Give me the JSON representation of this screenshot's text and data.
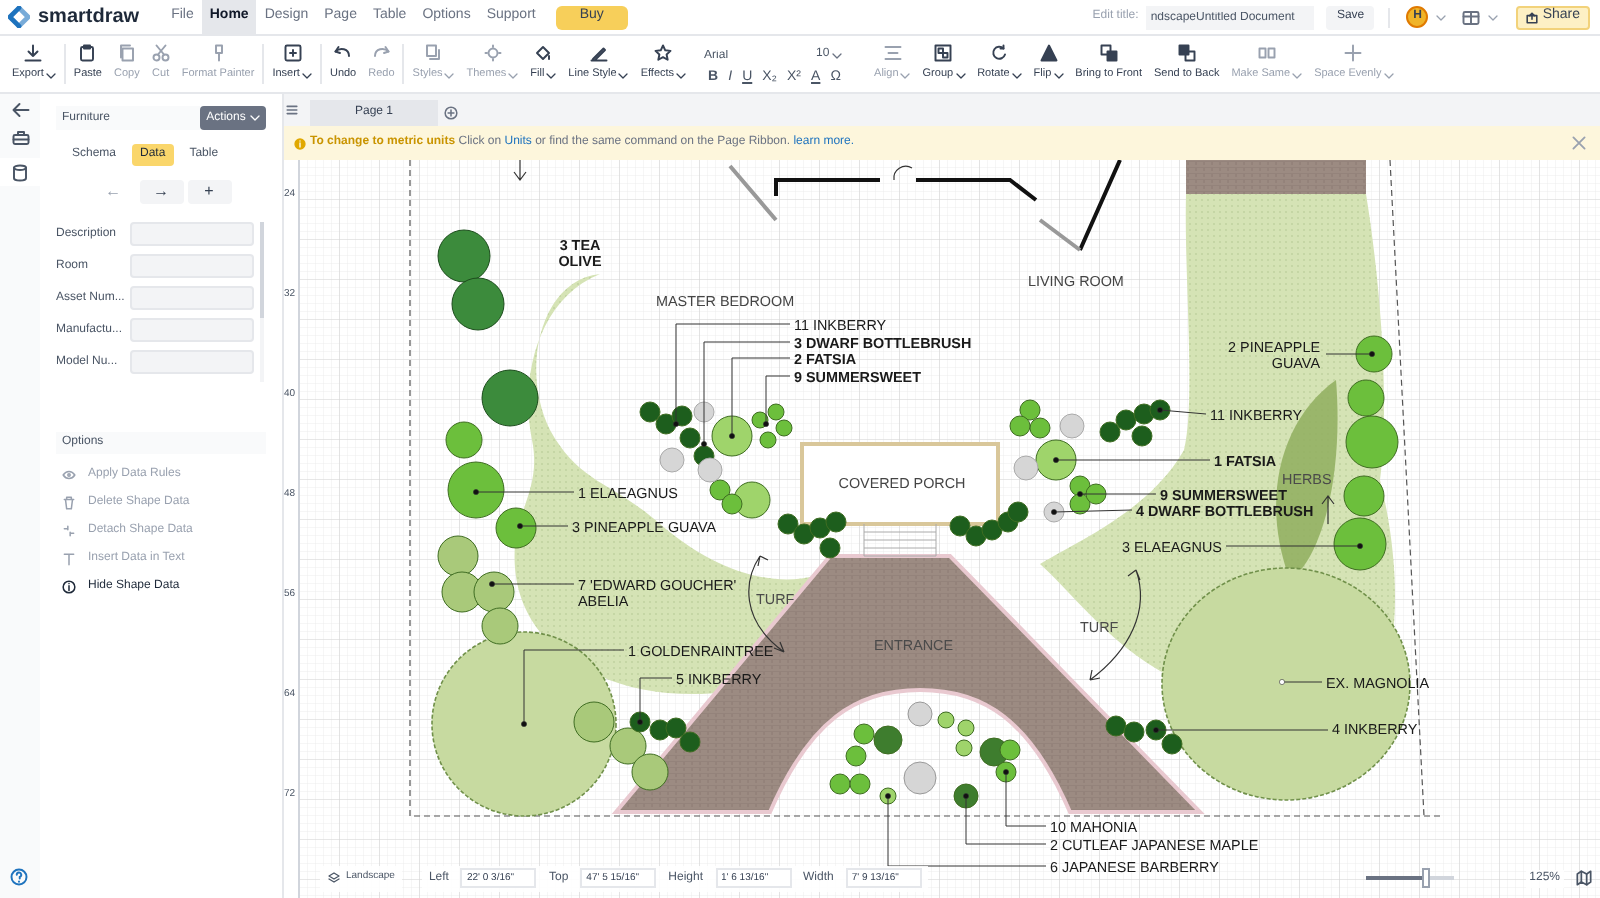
{
  "header": {
    "logo": "smartdraw",
    "menu": [
      {
        "label": "File",
        "selected": false
      },
      {
        "label": "Home",
        "selected": true
      },
      {
        "label": "Design",
        "selected": false
      },
      {
        "label": "Page",
        "selected": false
      },
      {
        "label": "Table",
        "selected": false
      },
      {
        "label": "Options",
        "selected": false
      },
      {
        "label": "Support",
        "selected": false
      }
    ],
    "buy_button": "Buy",
    "edit_title_label": "Edit title:",
    "title_field": {
      "value": "ndscapeUntitled Document"
    },
    "save_button": "Save",
    "avatar": "H",
    "share_button": "Share"
  },
  "ribbon": {
    "left": [
      {
        "label": "Export",
        "dropdown": true,
        "disabled": false
      },
      {
        "label": "Paste",
        "dropdown": false,
        "disabled": false
      },
      {
        "label": "Copy",
        "dropdown": false,
        "disabled": true
      },
      {
        "label": "Cut",
        "dropdown": false,
        "disabled": true
      },
      {
        "label": "Format Painter",
        "dropdown": false,
        "disabled": true
      },
      {
        "label": "Insert",
        "dropdown": true,
        "disabled": false
      },
      {
        "label": "Undo",
        "dropdown": false,
        "disabled": false
      },
      {
        "label": "Redo",
        "dropdown": false,
        "disabled": true
      },
      {
        "label": "Styles",
        "dropdown": true,
        "disabled": true
      },
      {
        "label": "Themes",
        "dropdown": true,
        "disabled": true
      },
      {
        "label": "Fill",
        "dropdown": true,
        "disabled": false
      },
      {
        "label": "Line Style",
        "dropdown": true,
        "disabled": false
      },
      {
        "label": "Effects",
        "dropdown": true,
        "disabled": false
      }
    ],
    "font": {
      "family": "Arial",
      "size": "10"
    },
    "format_buttons": [
      "B",
      "I",
      "U",
      "X₂",
      "X²",
      "A",
      "Ω"
    ],
    "right": [
      {
        "label": "Align",
        "dropdown": true,
        "disabled": true
      },
      {
        "label": "Group",
        "dropdown": true,
        "disabled": false
      },
      {
        "label": "Rotate",
        "dropdown": true,
        "disabled": false
      },
      {
        "label": "Flip",
        "dropdown": true,
        "disabled": false
      },
      {
        "label": "Bring to Front",
        "dropdown": false,
        "disabled": false
      },
      {
        "label": "Send to Back",
        "dropdown": false,
        "disabled": false
      },
      {
        "label": "Make Same",
        "dropdown": true,
        "disabled": true
      },
      {
        "label": "Space Evenly",
        "dropdown": true,
        "disabled": true
      }
    ]
  },
  "left_panel": {
    "category_field": {
      "value": "Furniture"
    },
    "actions_button": "Actions",
    "tabs": [
      {
        "label": "Schema",
        "selected": false
      },
      {
        "label": "Data",
        "selected": true
      },
      {
        "label": "Table",
        "selected": false
      }
    ],
    "nav_buttons": [
      {
        "label": "←",
        "disabled": true
      },
      {
        "label": "→",
        "disabled": false
      },
      {
        "label": "+",
        "disabled": false
      }
    ],
    "fields": [
      {
        "label": "Description"
      },
      {
        "label": "Room"
      },
      {
        "label": "Asset Num..."
      },
      {
        "label": "Manufactu..."
      },
      {
        "label": "Model Nu..."
      }
    ],
    "options_title": "Options",
    "options": [
      {
        "label": "Apply Data Rules",
        "disabled": true
      },
      {
        "label": "Delete Shape Data",
        "disabled": true
      },
      {
        "label": "Detach Shape Data",
        "disabled": true
      },
      {
        "label": "Insert Data in Text",
        "disabled": true
      },
      {
        "label": "Hide Shape Data",
        "disabled": false
      }
    ]
  },
  "page_tabs": [
    {
      "label": "Page 1",
      "selected": true
    }
  ],
  "notice": {
    "parts": [
      {
        "text": "To change to metric units",
        "kind": "bold"
      },
      {
        "text": "Click on",
        "kind": "plain"
      },
      {
        "text": "Units",
        "kind": "link"
      },
      {
        "text": "or find the same command on the Page Ribbon.",
        "kind": "plain"
      },
      {
        "text": "learn more.",
        "kind": "link"
      }
    ]
  },
  "ruler": [
    "24",
    "32",
    "40",
    "48",
    "56",
    "64",
    "72"
  ],
  "plan_labels": [
    {
      "lines": [
        "3 TEA",
        "OLIVE"
      ],
      "kind": "plant",
      "bold": true
    },
    {
      "lines": [
        "MASTER BEDROOM"
      ],
      "kind": "room",
      "bold": false
    },
    {
      "lines": [
        "LIVING ROOM"
      ],
      "kind": "room",
      "bold": false
    },
    {
      "lines": [
        "11 INKBERRY"
      ],
      "kind": "plant",
      "bold": false
    },
    {
      "lines": [
        "3 DWARF BOTTLEBRUSH"
      ],
      "kind": "plant",
      "bold": true
    },
    {
      "lines": [
        "2 FATSIA"
      ],
      "kind": "plant",
      "bold": true
    },
    {
      "lines": [
        "9 SUMMERSWEET"
      ],
      "kind": "plant",
      "bold": true
    },
    {
      "lines": [
        "2 PINEAPPLE",
        "GUAVA"
      ],
      "kind": "plant",
      "bold": false
    },
    {
      "lines": [
        "11 INKBERRY"
      ],
      "kind": "plant",
      "bold": false
    },
    {
      "lines": [
        "COVERED PORCH"
      ],
      "kind": "room",
      "bold": false
    },
    {
      "lines": [
        "1 FATSIA"
      ],
      "kind": "plant",
      "bold": true
    },
    {
      "lines": [
        "HERBS"
      ],
      "kind": "area",
      "bold": false
    },
    {
      "lines": [
        "1 ELAEAGNUS"
      ],
      "kind": "plant",
      "bold": false
    },
    {
      "lines": [
        "9 SUMMERSWEET"
      ],
      "kind": "plant",
      "bold": true
    },
    {
      "lines": [
        "4 DWARF BOTTLEBRUSH"
      ],
      "kind": "plant",
      "bold": true
    },
    {
      "lines": [
        "3 PINEAPPLE GUAVA"
      ],
      "kind": "plant",
      "bold": false
    },
    {
      "lines": [
        "3 ELAEAGNUS"
      ],
      "kind": "plant",
      "bold": false
    },
    {
      "lines": [
        "7 'EDWARD GOUCHER'",
        "ABELIA"
      ],
      "kind": "plant",
      "bold": false
    },
    {
      "lines": [
        "TURF"
      ],
      "kind": "area",
      "bold": false
    },
    {
      "lines": [
        "TURF"
      ],
      "kind": "area",
      "bold": false
    },
    {
      "lines": [
        "ENTRANCE"
      ],
      "kind": "area",
      "bold": false
    },
    {
      "lines": [
        "1 GOLDENRAINTREE"
      ],
      "kind": "plant",
      "bold": false
    },
    {
      "lines": [
        "5 INKBERRY"
      ],
      "kind": "plant",
      "bold": false
    },
    {
      "lines": [
        "EX. MAGNOLIA"
      ],
      "kind": "plant",
      "bold": false
    },
    {
      "lines": [
        "4 INKBERRY"
      ],
      "kind": "plant",
      "bold": false
    },
    {
      "lines": [
        "10 MAHONIA"
      ],
      "kind": "plant",
      "bold": false
    },
    {
      "lines": [
        "2 CUTLEAF JAPANESE MAPLE"
      ],
      "kind": "plant",
      "bold": false
    },
    {
      "lines": [
        "6 JAPANESE BARBERRY"
      ],
      "kind": "plant",
      "bold": false
    }
  ],
  "bottom_bar": {
    "shape_name": "Landscape",
    "position_fields": [
      {
        "label": "Left",
        "value": "22' 0 3/16\""
      },
      {
        "label": "Top",
        "value": "47' 5 15/16\""
      },
      {
        "label": "Height",
        "value": "1' 6 13/16\""
      },
      {
        "label": "Width",
        "value": "7' 9 13/16\""
      }
    ],
    "zoom": {
      "level": 0.7,
      "reading": "125%"
    }
  }
}
